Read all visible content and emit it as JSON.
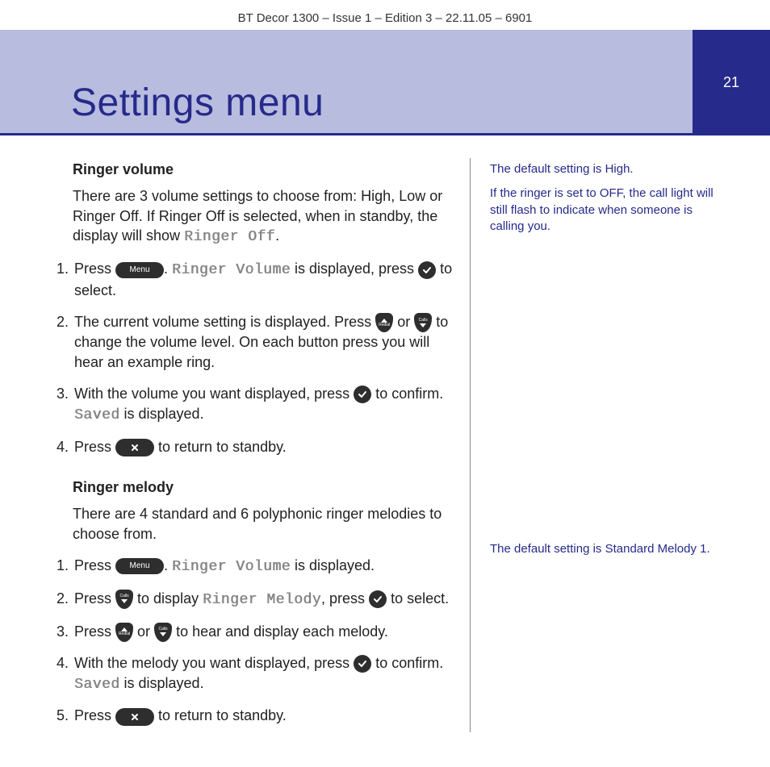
{
  "runningHead": "BT Decor 1300 – Issue 1 – Edition 3 – 22.11.05 – 6901",
  "pageTitle": "Settings menu",
  "pageNumber": "21",
  "section1": {
    "heading": "Ringer volume",
    "intro_a": "There are 3 volume settings to choose from: High, Low or Ringer Off. If Ringer Off is selected, when in standby, the display will show ",
    "intro_lcd": "Ringer Off",
    "intro_b": ".",
    "step1_a": "Press ",
    "step1_b": ". ",
    "step1_lcd": "Ringer Volume",
    "step1_c": " is displayed, press ",
    "step1_d": " to select.",
    "step2_a": "The current volume setting is displayed. Press ",
    "step2_b": " or ",
    "step2_c": " to change the volume level. On each button press you will hear an example ring.",
    "step3_a": "With the volume you want displayed, press ",
    "step3_b": " to confirm. ",
    "step3_lcd": "Saved",
    "step3_c": " is displayed.",
    "step4_a": "Press ",
    "step4_b": " to return to standby."
  },
  "section2": {
    "heading": "Ringer melody",
    "intro": "There are 4 standard and 6 polyphonic ringer melodies to choose from.",
    "step1_a": "Press ",
    "step1_b": ". ",
    "step1_lcd": "Ringer Volume",
    "step1_c": " is displayed.",
    "step2_a": "Press ",
    "step2_b": " to display ",
    "step2_lcd": "Ringer Melody",
    "step2_c": ", press ",
    "step2_d": " to select.",
    "step3_a": "Press ",
    "step3_b": " or ",
    "step3_c": " to hear and display each melody.",
    "step4_a": "With the melody you want displayed, press ",
    "step4_b": " to confirm. ",
    "step4_lcd": "Saved",
    "step4_c": " is displayed.",
    "step5_a": "Press ",
    "step5_b": " to return to standby."
  },
  "sidebar": {
    "note1a": "The default setting is High.",
    "note1b": "If the ringer is set to OFF, the call light will still flash to indicate when someone is calling you.",
    "note2": "The default setting is Standard Melody 1."
  },
  "buttons": {
    "menu": "Menu",
    "upLabel": "Redial",
    "downLabel": "Calls"
  }
}
